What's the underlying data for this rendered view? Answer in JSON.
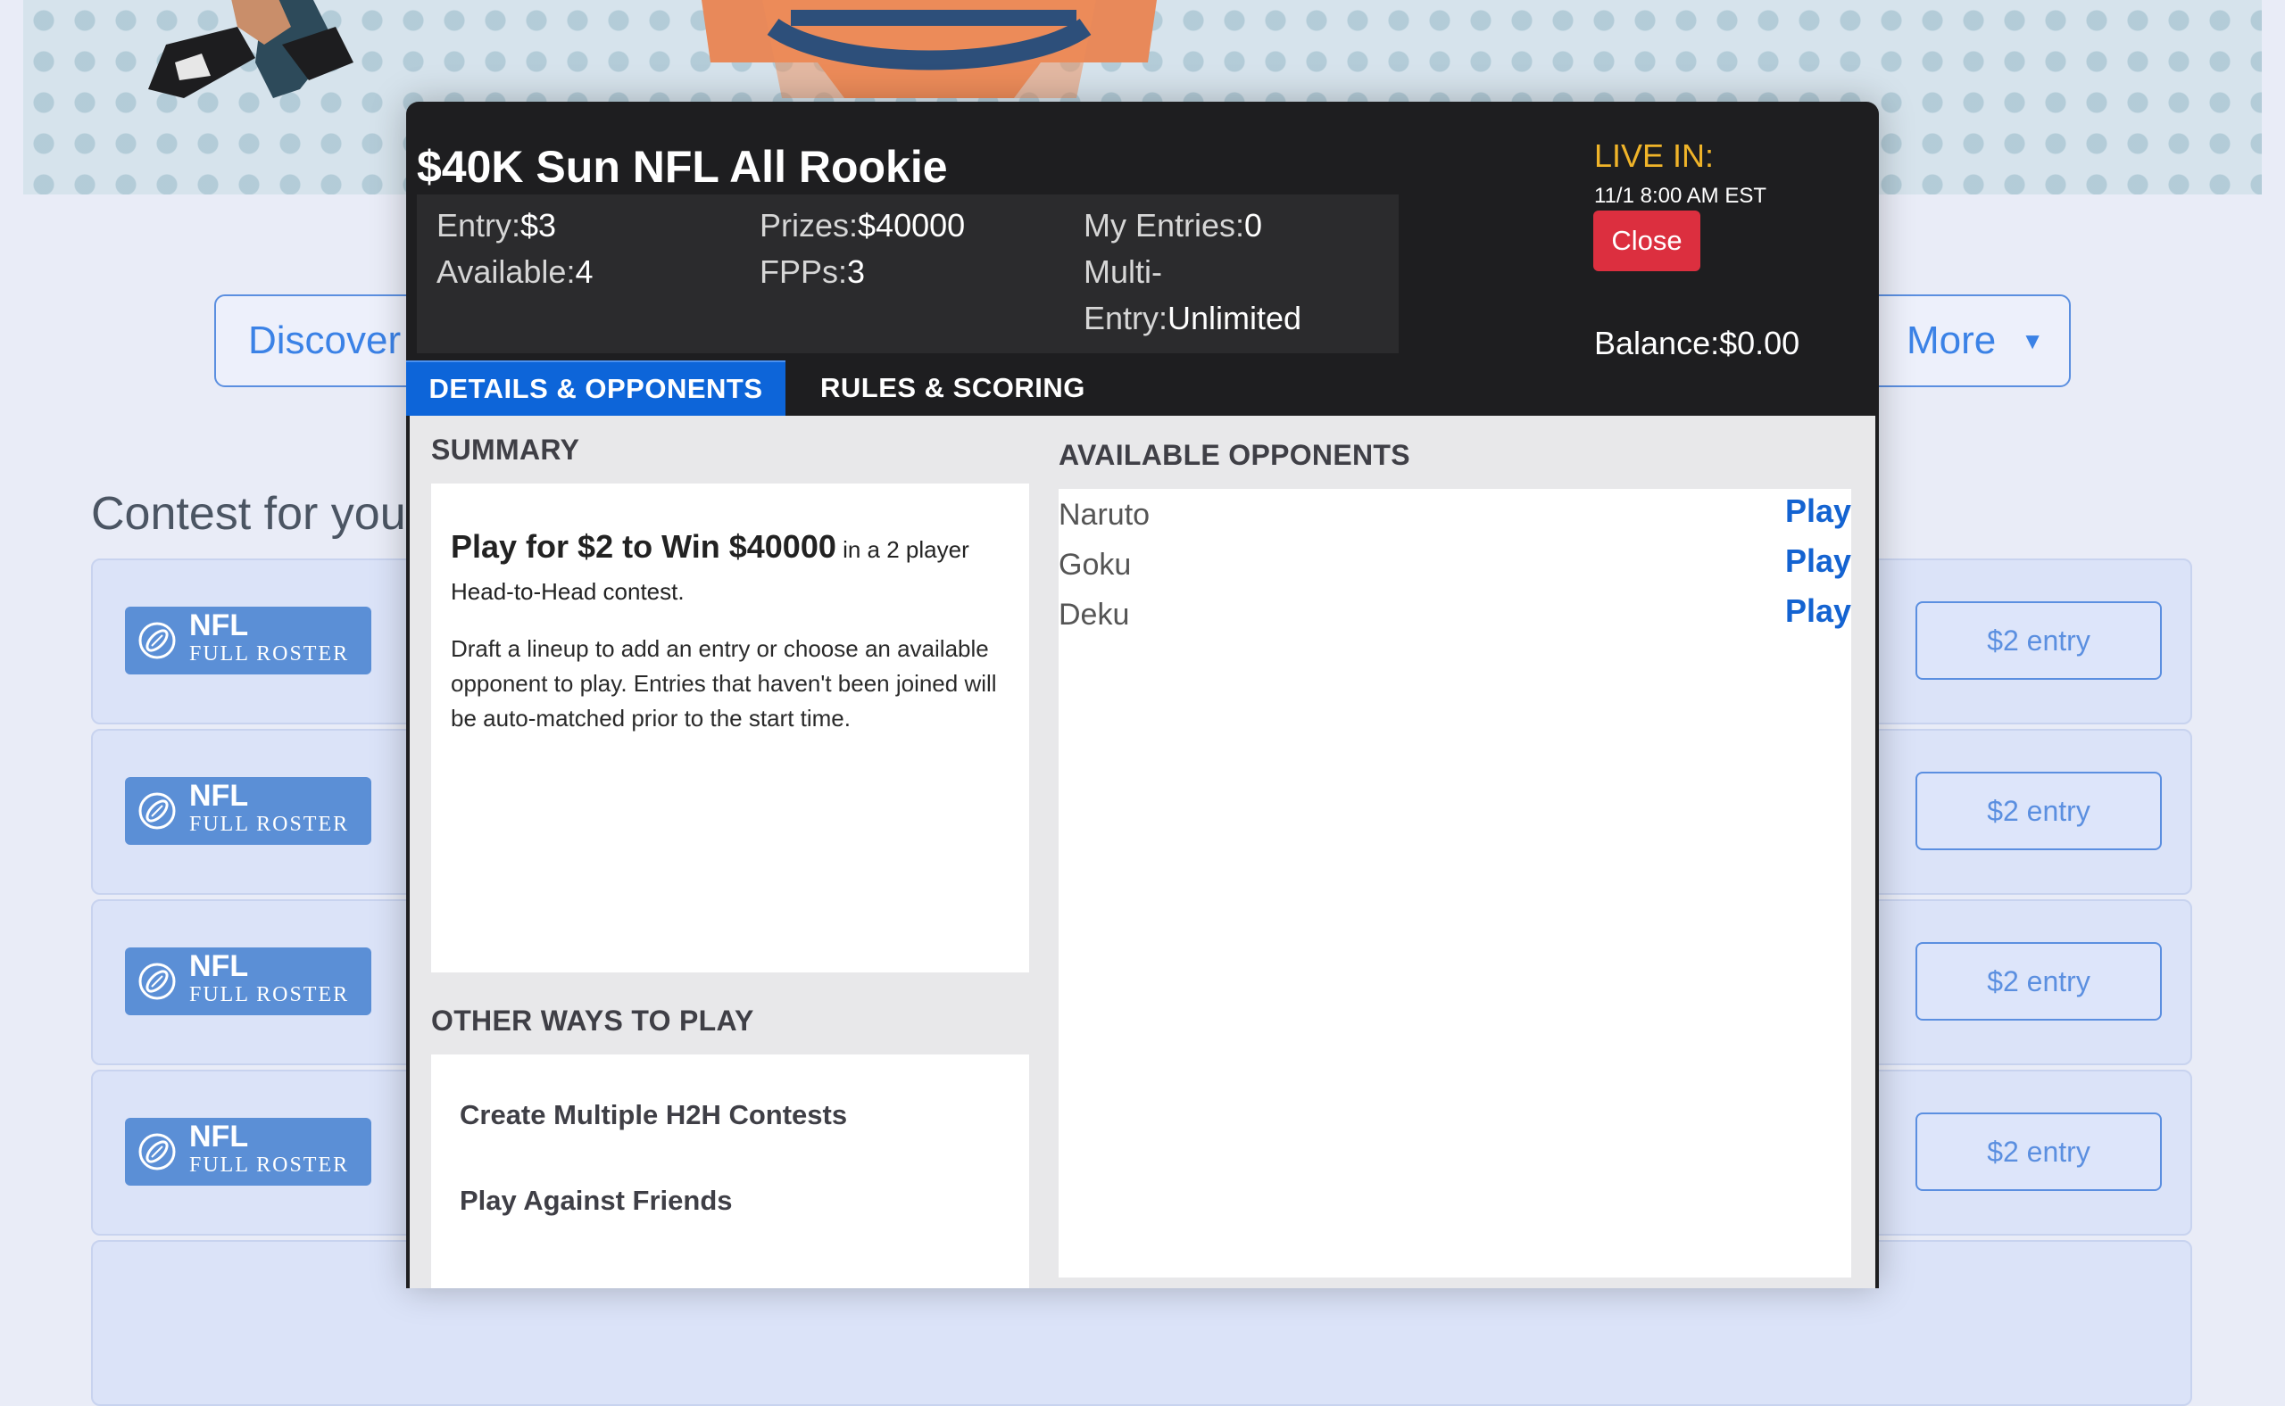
{
  "background": {
    "nav": {
      "discover_label": "Discover",
      "more_label": "More"
    },
    "section_title": "Contest for you",
    "contest_rows": [
      {
        "sport": "NFL",
        "type": "FULL ROSTER",
        "entry_label": "$2 entry"
      },
      {
        "sport": "NFL",
        "type": "FULL ROSTER",
        "entry_label": "$2 entry"
      },
      {
        "sport": "NFL",
        "type": "FULL ROSTER",
        "entry_label": "$2 entry"
      },
      {
        "sport": "NFL",
        "type": "FULL ROSTER",
        "entry_label": "$2 entry"
      }
    ]
  },
  "modal": {
    "title": "$40K Sun NFL All Rookie",
    "info": {
      "entry_label": "Entry:",
      "entry_value": "$3",
      "available_label": "Available:",
      "available_value": "4",
      "prizes_label": "Prizes:",
      "prizes_value": "$40000",
      "fpps_label": "FPPs:",
      "fpps_value": "3",
      "my_entries_label": "My Entries:",
      "my_entries_value": "0",
      "multi_label_1": "Multi-",
      "multi_label_2": "Entry:",
      "multi_value": "Unlimited"
    },
    "live_label": "LIVE IN:",
    "live_time": "11/1 8:00 AM EST",
    "close_label": "Close",
    "balance_label": "Balance:",
    "balance_value": "$0.00",
    "tabs": [
      {
        "label": "DETAILS & OPPONENTS",
        "active": true
      },
      {
        "label": "RULES & SCORING",
        "active": false
      }
    ],
    "summary": {
      "heading": "SUMMARY",
      "headline_bold": "Play for $2 to Win $40000",
      "headline_rest": " in a 2 player Head-to-Head contest.",
      "description": "Draft a lineup to add an entry or choose an available opponent to play. Entries that haven't been joined will be auto-matched prior to the start time."
    },
    "other_ways": {
      "heading": "OTHER WAYS TO PLAY",
      "items": [
        "Create Multiple H2H Contests",
        "Play Against Friends"
      ]
    },
    "opponents": {
      "heading": "AVAILABLE OPPONENTS",
      "play_label": "Play",
      "list": [
        "Naruto",
        "Goku",
        "Deku"
      ]
    }
  },
  "colors": {
    "accent_blue": "#0d65d9",
    "close_red": "#dc2f3f",
    "live_yellow": "#f0b429",
    "modal_dark": "#1e1e20"
  },
  "icons": [
    "football-icon",
    "chevron-down-icon"
  ]
}
